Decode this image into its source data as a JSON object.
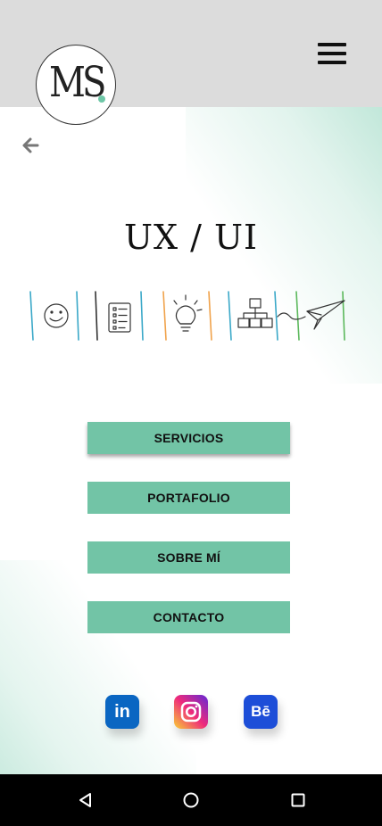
{
  "header": {
    "logo_text": "MS",
    "menu_icon": "hamburger-menu-icon",
    "background": "#dcdcdc"
  },
  "main": {
    "back_icon": "arrow-left-icon",
    "title": "UX / UI",
    "illustration_icons": [
      "smiley-face-icon",
      "checklist-icon",
      "lightbulb-icon",
      "flowchart-icon",
      "paper-plane-icon"
    ],
    "buttons": [
      {
        "label": "SERVICIOS"
      },
      {
        "label": "PORTAFOLIO"
      },
      {
        "label": "SOBRE MÍ"
      },
      {
        "label": "CONTACTO"
      }
    ],
    "social": [
      {
        "name": "LinkedIn",
        "glyph": "in",
        "icon": "linkedin-icon"
      },
      {
        "name": "Instagram",
        "icon": "instagram-icon"
      },
      {
        "name": "Behance",
        "glyph": "Bē",
        "icon": "behance-icon"
      }
    ]
  },
  "navbar": {
    "back": "triangle-back-icon",
    "home": "circle-home-icon",
    "recents": "square-recents-icon"
  },
  "colors": {
    "accent": "#72c4a6",
    "logo_dot": "#6ec7a7",
    "navbar": "#000000"
  }
}
